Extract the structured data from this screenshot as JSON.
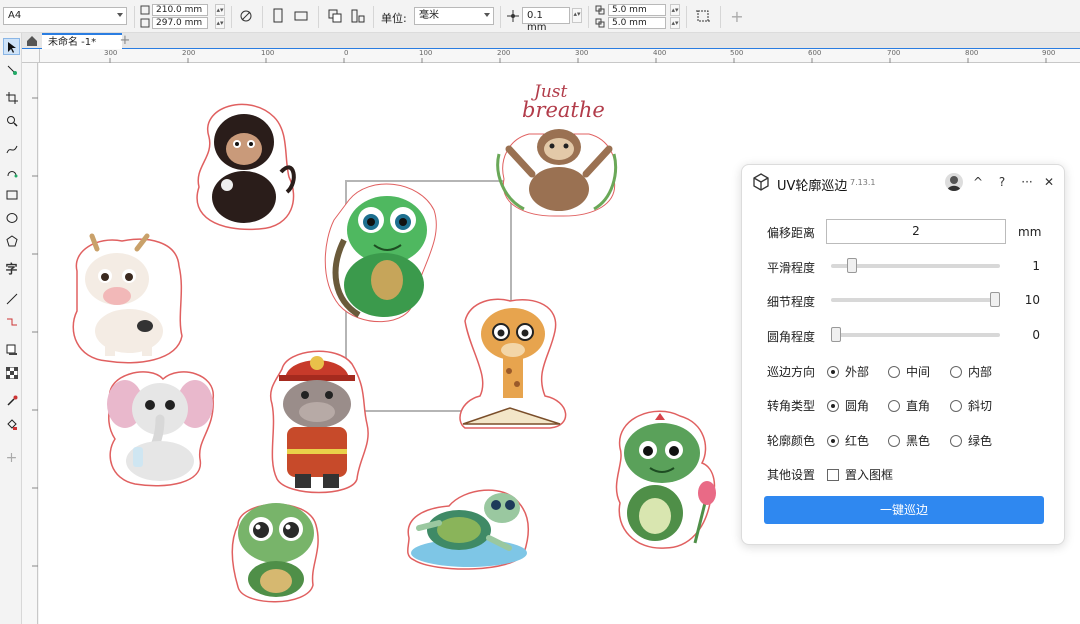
{
  "toolbar": {
    "paper_size": "A4",
    "width": "210.0 mm",
    "height": "297.0 mm",
    "units_label": "单位:",
    "units_value": "毫米",
    "nudge": "0.1 mm",
    "dup_x": "5.0 mm",
    "dup_y": "5.0 mm"
  },
  "document_tab": {
    "label": "未命名 -1*"
  },
  "ruler": {
    "h_ticks": [
      "300",
      "200",
      "100",
      "0",
      "100",
      "200",
      "300",
      "400",
      "500",
      "600",
      "700",
      "800",
      "900"
    ],
    "v_ticks": [
      "0",
      "5",
      "10",
      "15",
      "20",
      "25",
      "30",
      "35",
      "40"
    ]
  },
  "sticker_text": {
    "just": "Just",
    "breathe": "breathe"
  },
  "panel": {
    "title": "UV轮廓巡边",
    "version": "7.13.1",
    "collapse_icon": "^",
    "help_icon": "?",
    "more_icon": "···",
    "close_icon": "✕",
    "offset_label": "偏移距离",
    "offset_value": "2",
    "offset_unit": "mm",
    "smooth_label": "平滑程度",
    "smooth_value": "1",
    "smooth_fraction": 0.1,
    "detail_label": "细节程度",
    "detail_value": "10",
    "detail_fraction": 1.0,
    "corner_label": "圆角程度",
    "corner_value": "0",
    "corner_fraction": 0.0,
    "direction_label": "巡边方向",
    "direction_options": [
      "外部",
      "中间",
      "内部"
    ],
    "direction_selected": 0,
    "turn_label": "转角类型",
    "turn_options": [
      "圆角",
      "直角",
      "斜切"
    ],
    "turn_selected": 0,
    "color_label": "轮廓颜色",
    "color_options": [
      "红色",
      "黑色",
      "绿色"
    ],
    "color_selected": 0,
    "other_label": "其他设置",
    "other_option": "置入图框",
    "other_checked": false,
    "action_button": "一键巡边"
  },
  "colors": {
    "accent": "#2f88f0",
    "outline": "#e06060"
  }
}
